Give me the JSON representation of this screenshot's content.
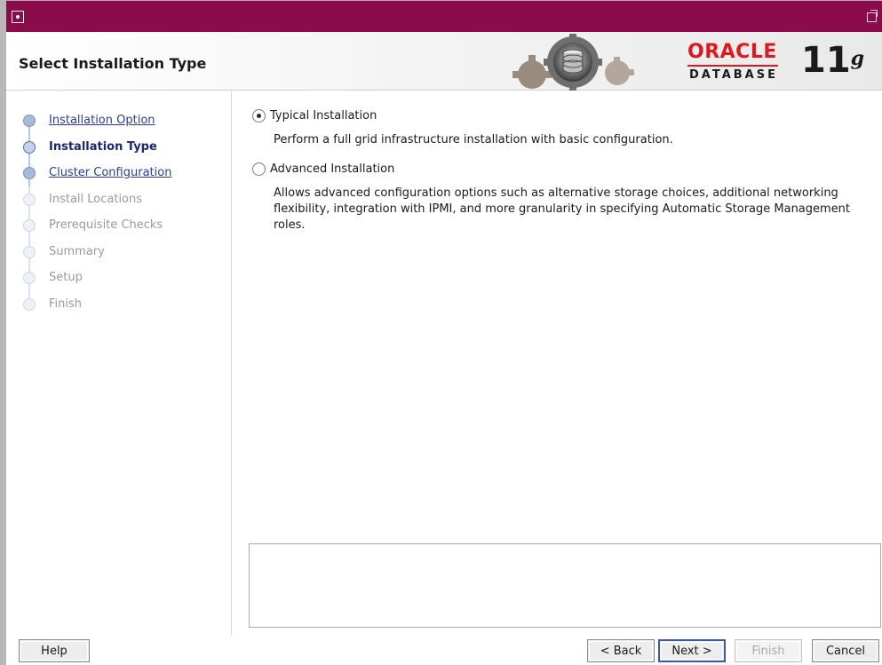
{
  "header": {
    "title": "Select Installation Type",
    "brand": {
      "oracle": "ORACLE",
      "database": "DATABASE",
      "version": "11",
      "version_sup": "g"
    }
  },
  "sidebar": {
    "steps": [
      {
        "label": "Installation Option",
        "state": "done"
      },
      {
        "label": "Installation Type",
        "state": "current"
      },
      {
        "label": "Cluster Configuration",
        "state": "done"
      },
      {
        "label": "Install Locations",
        "state": "pending"
      },
      {
        "label": "Prerequisite Checks",
        "state": "pending"
      },
      {
        "label": "Summary",
        "state": "pending"
      },
      {
        "label": "Setup",
        "state": "pending"
      },
      {
        "label": "Finish",
        "state": "pending"
      }
    ]
  },
  "main": {
    "typical": {
      "label": "Typical Installation",
      "selected": true,
      "description": "Perform a full grid infrastructure installation with basic configuration."
    },
    "advanced": {
      "label": "Advanced Installation",
      "selected": false,
      "description": "Allows advanced configuration options such as alternative storage choices, additional networking flexibility, integration with IPMI, and more granularity in specifying Automatic Storage Management roles."
    },
    "message": ""
  },
  "footer": {
    "help": "Help",
    "back": "< Back",
    "next": "Next >",
    "finish": "Finish",
    "cancel": "Cancel"
  },
  "colors": {
    "titlebar": "#8c0b4d",
    "oracle_red": "#e1171e",
    "link": "#2a3d8f"
  }
}
